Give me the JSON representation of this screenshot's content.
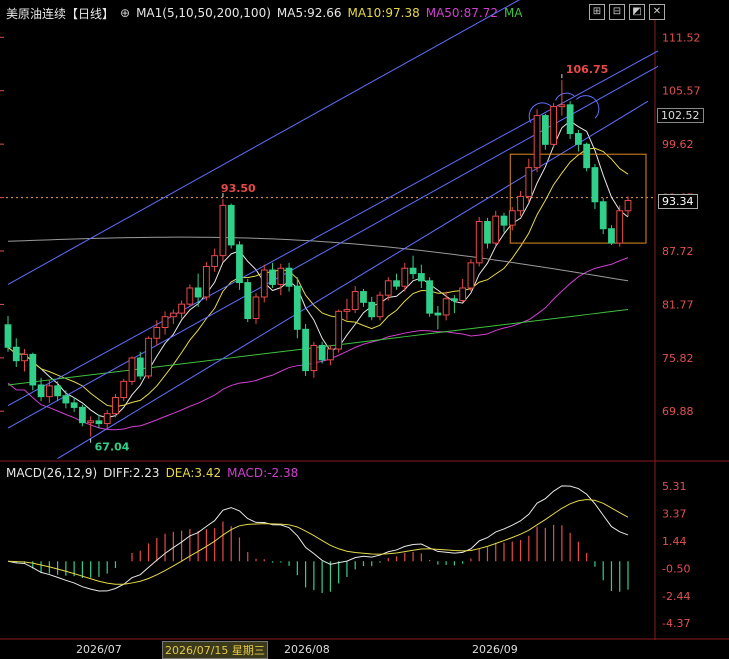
{
  "header": {
    "instrument": "美原油连续【日线】",
    "ma_params": "MA1(5,10,50,200,100)",
    "ma5": "MA5:92.66",
    "ma10": "MA10:97.38",
    "ma50": "MA50:87.72",
    "ma_extra": "MA"
  },
  "macd_header": {
    "params": "MACD(26,12,9)",
    "diff": "DIFF:2.23",
    "dea": "DEA:3.42",
    "macd": "MACD:-2.38"
  },
  "x_axis": {
    "labels": [
      "2026/07",
      "2026/07/15 星期三",
      "2026/08",
      "2026/09"
    ]
  },
  "price_tags": {
    "current": "93.34",
    "marker": "102.52"
  },
  "colors": {
    "up": "#e84a4a",
    "down": "#30d08a",
    "ma5": "#e8e8e8",
    "ma10": "#e6d84a",
    "ma50": "#d040d0",
    "ma200": "#40c040",
    "ma100": "#9a9a9a",
    "channel": "#6070ff",
    "box": "#e08a20",
    "diff": "#e8e8e8",
    "dea": "#e6d84a"
  },
  "chart_data": [
    {
      "type": "candlestick",
      "title": "美原油连续【日线】",
      "y_ticks": [
        111.52,
        105.57,
        99.62,
        93.67,
        87.72,
        81.77,
        75.82,
        69.88
      ],
      "ylim": [
        65,
        113
      ],
      "annotations": [
        {
          "label": "106.75",
          "value": 106.75,
          "kind": "high"
        },
        {
          "label": "93.50",
          "value": 93.5,
          "kind": "high"
        },
        {
          "label": "67.04",
          "value": 67.04,
          "kind": "low"
        }
      ],
      "candles": [
        [
          79.5,
          80.5,
          76.5,
          77.0
        ],
        [
          77.0,
          78.0,
          74.8,
          75.5
        ],
        [
          75.5,
          76.8,
          74.3,
          76.2
        ],
        [
          76.2,
          76.4,
          72.2,
          72.8
        ],
        [
          72.8,
          73.6,
          71.0,
          71.5
        ],
        [
          71.5,
          73.4,
          70.8,
          72.7
        ],
        [
          72.7,
          73.2,
          71.0,
          71.6
        ],
        [
          71.6,
          72.2,
          70.2,
          70.8
        ],
        [
          70.8,
          71.4,
          69.8,
          70.3
        ],
        [
          70.3,
          70.6,
          68.2,
          68.6
        ],
        [
          68.6,
          69.3,
          67.04,
          68.8
        ],
        [
          68.8,
          69.5,
          68.0,
          68.5
        ],
        [
          68.5,
          70.0,
          67.8,
          69.6
        ],
        [
          69.6,
          71.8,
          69.2,
          71.4
        ],
        [
          71.4,
          73.5,
          71.0,
          73.2
        ],
        [
          73.2,
          76.0,
          72.8,
          75.8
        ],
        [
          75.8,
          76.5,
          73.4,
          73.8
        ],
        [
          73.8,
          78.2,
          73.5,
          78.0
        ],
        [
          78.0,
          80.0,
          77.2,
          79.2
        ],
        [
          79.2,
          81.0,
          78.4,
          80.4
        ],
        [
          80.4,
          81.2,
          79.6,
          80.8
        ],
        [
          80.8,
          82.2,
          80.2,
          81.8
        ],
        [
          81.8,
          84.0,
          81.5,
          83.6
        ],
        [
          83.6,
          85.2,
          81.5,
          82.6
        ],
        [
          82.6,
          86.5,
          82.2,
          86.0
        ],
        [
          86.0,
          88.0,
          85.4,
          87.2
        ],
        [
          87.2,
          93.5,
          86.5,
          92.8
        ],
        [
          92.8,
          93.0,
          88.0,
          88.4
        ],
        [
          88.4,
          88.8,
          83.4,
          84.2
        ],
        [
          84.2,
          84.6,
          79.8,
          80.2
        ],
        [
          80.2,
          83.0,
          79.6,
          82.6
        ],
        [
          82.6,
          86.2,
          82.0,
          85.6
        ],
        [
          85.6,
          86.4,
          83.6,
          84.0
        ],
        [
          84.0,
          86.3,
          82.8,
          85.8
        ],
        [
          85.8,
          86.4,
          83.2,
          83.8
        ],
        [
          83.8,
          84.8,
          78.0,
          79.0
        ],
        [
          79.0,
          79.6,
          73.8,
          74.4
        ],
        [
          74.4,
          77.6,
          73.6,
          77.2
        ],
        [
          77.2,
          77.6,
          75.2,
          75.6
        ],
        [
          75.6,
          77.2,
          75.0,
          76.8
        ],
        [
          76.8,
          81.2,
          76.4,
          81.0
        ],
        [
          81.0,
          82.4,
          80.0,
          81.2
        ],
        [
          81.2,
          83.8,
          80.8,
          83.2
        ],
        [
          83.2,
          83.5,
          81.5,
          82.0
        ],
        [
          82.0,
          82.6,
          80.0,
          80.4
        ],
        [
          80.4,
          83.2,
          80.0,
          82.8
        ],
        [
          82.8,
          84.8,
          82.2,
          84.4
        ],
        [
          84.4,
          85.2,
          83.4,
          83.8
        ],
        [
          83.8,
          86.4,
          83.2,
          85.8
        ],
        [
          85.8,
          87.2,
          84.6,
          85.2
        ],
        [
          85.2,
          86.2,
          83.6,
          84.4
        ],
        [
          84.4,
          84.8,
          80.4,
          80.8
        ],
        [
          80.8,
          81.6,
          79.0,
          80.6
        ],
        [
          80.6,
          83.2,
          80.0,
          82.4
        ],
        [
          82.4,
          82.8,
          80.8,
          82.2
        ],
        [
          82.2,
          84.6,
          82.0,
          83.6
        ],
        [
          83.6,
          86.8,
          83.2,
          86.4
        ],
        [
          86.4,
          91.5,
          86.0,
          91.0
        ],
        [
          91.0,
          91.4,
          88.0,
          88.6
        ],
        [
          88.6,
          92.2,
          88.2,
          91.6
        ],
        [
          91.6,
          92.0,
          89.8,
          90.6
        ],
        [
          90.6,
          92.6,
          90.0,
          92.2
        ],
        [
          92.2,
          94.4,
          91.6,
          93.8
        ],
        [
          93.8,
          98.0,
          93.2,
          97.0
        ],
        [
          97.0,
          103.5,
          96.5,
          102.8
        ],
        [
          102.8,
          103.0,
          99.0,
          99.6
        ],
        [
          99.6,
          104.2,
          99.2,
          103.8
        ],
        [
          103.8,
          106.75,
          102.8,
          104.0
        ],
        [
          104.0,
          104.4,
          100.2,
          100.8
        ],
        [
          100.8,
          101.2,
          98.8,
          99.6
        ],
        [
          99.6,
          99.8,
          96.6,
          97.0
        ],
        [
          97.0,
          97.4,
          92.4,
          93.2
        ],
        [
          93.2,
          93.6,
          89.6,
          90.2
        ],
        [
          90.2,
          90.6,
          88.4,
          88.6
        ],
        [
          88.6,
          92.8,
          88.2,
          92.2
        ],
        [
          92.2,
          93.8,
          91.6,
          93.34
        ]
      ]
    },
    {
      "type": "bar",
      "title": "MACD(26,12,9)",
      "y_ticks": [
        5.31,
        3.37,
        1.44,
        -0.5,
        -2.44,
        -4.37
      ],
      "ylim": [
        -5.0,
        5.6
      ]
    }
  ]
}
